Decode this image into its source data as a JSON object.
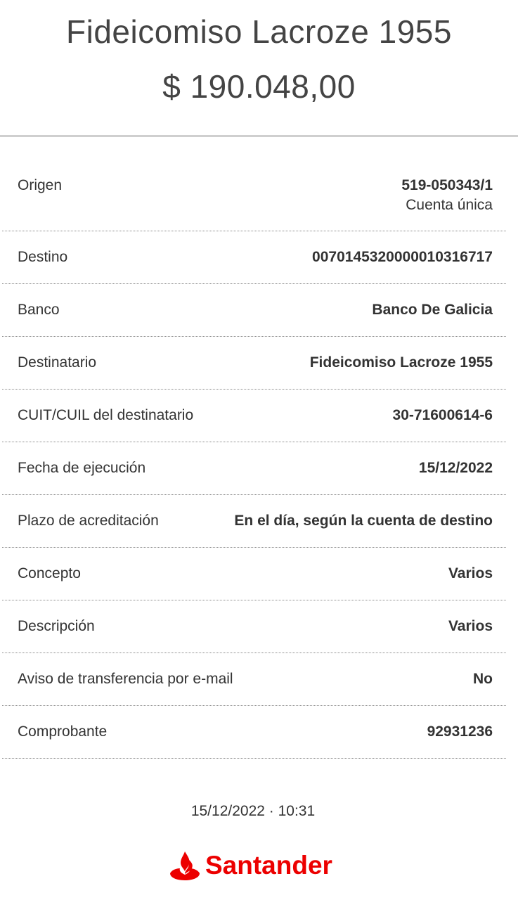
{
  "header": {
    "title": "Fideicomiso Lacroze 1955",
    "amount": "$ 190.048,00"
  },
  "details": [
    {
      "label": "Origen",
      "value": "519-050343/1",
      "sub": "Cuenta única"
    },
    {
      "label": "Destino",
      "value": "0070145320000010316717"
    },
    {
      "label": "Banco",
      "value": "Banco De Galicia"
    },
    {
      "label": "Destinatario",
      "value": "Fideicomiso Lacroze 1955"
    },
    {
      "label": "CUIT/CUIL del destinatario",
      "value": "30-71600614-6"
    },
    {
      "label": "Fecha de ejecución",
      "value": "15/12/2022"
    },
    {
      "label": "Plazo de acreditación",
      "value": "En el día, según la cuenta de destino"
    },
    {
      "label": "Concepto",
      "value": "Varios"
    },
    {
      "label": "Descripción",
      "value": "Varios"
    },
    {
      "label": "Aviso de transferencia por e-mail",
      "value": "No"
    },
    {
      "label": "Comprobante",
      "value": "92931236"
    }
  ],
  "footer": {
    "timestamp": "15/12/2022 · 10:31",
    "brand": "Santander",
    "brand_color": "#ec0000",
    "brand_icon": "santander-flame-icon"
  }
}
